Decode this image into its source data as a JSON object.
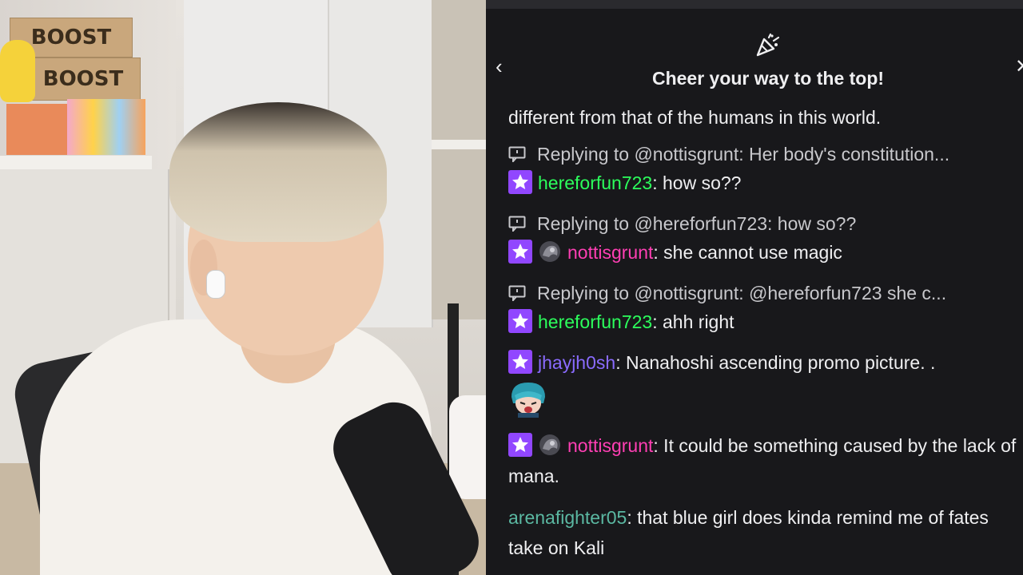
{
  "header": {
    "title": "Cheer your way to the top!",
    "back_icon": "chevron-left-icon",
    "close_icon": "close-icon",
    "party_icon": "party-popper-icon"
  },
  "colors": {
    "panel_bg": "#18181b",
    "badge_purple": "#9147ff",
    "green": "#2cff5c",
    "pink": "#ff3fb4",
    "purple": "#8a6bff",
    "teal": "#5bb8a2"
  },
  "webcam": {
    "box_text_1": "BOOST",
    "box_text_2": "BOOST"
  },
  "chat": {
    "top_fragment": "different from that of the humans in this world.",
    "messages": [
      {
        "reply": "Replying to @nottisgrunt: Her body's constitution...",
        "user": "hereforfun723",
        "text": ": how so??"
      },
      {
        "reply": "Replying to @hereforfun723: how so??",
        "user": "nottisgrunt",
        "text": ": she cannot use magic"
      },
      {
        "reply": "Replying to @nottisgrunt: @hereforfun723 she c...",
        "user": "hereforfun723",
        "text": ": ahh right"
      },
      {
        "user": "jhayjh0sh",
        "text": ": Nanahoshi ascending promo picture. .",
        "emote": "anime-emote"
      },
      {
        "user": "nottisgrunt",
        "text": ": It could be something caused by the lack of mana."
      },
      {
        "user": "arenafighter05",
        "text": ": that blue girl does kinda remind me of fates take on Kali"
      }
    ]
  }
}
